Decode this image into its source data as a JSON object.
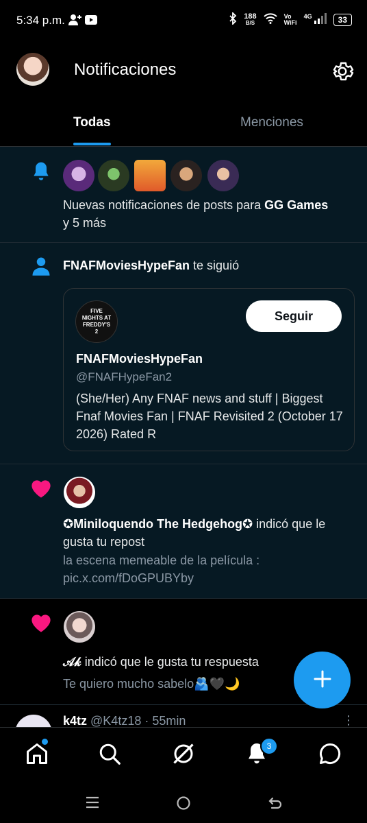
{
  "status_bar": {
    "time": "5:34 p.m.",
    "speed_top": "188",
    "speed_unit": "B/S",
    "network": "4G",
    "battery": "33"
  },
  "header": {
    "title": "Notificaciones"
  },
  "tabs": [
    {
      "label": "Todas",
      "active": true
    },
    {
      "label": "Menciones",
      "active": false
    }
  ],
  "notifications": {
    "n1": {
      "icon": "bell-icon",
      "text_a": "Nuevas notificaciones de posts para ",
      "text_bold": "GG Games",
      "text_b": " y 5 más"
    },
    "n2": {
      "icon": "person-icon",
      "user": "FNAFMoviesHypeFan",
      "action": " te siguió",
      "card": {
        "avatar_text": "FIVE NIGHTS AT FREDDY'S 2",
        "name": "FNAFMoviesHypeFan",
        "handle": "@FNAFHypeFan2",
        "bio": "(She/Her) Any FNAF news and stuff | Biggest Fnaf Movies Fan | FNAF Revisited 2 (October 17 2026) Rated R",
        "follow_label": "Seguir"
      }
    },
    "n3": {
      "icon": "heart-icon",
      "user": "✪Miniloquendo The Hedgehog✪",
      "action": " indicó que le gusta tu repost",
      "preview": "la escena memeable de la película : pic.x.com/fDoGPUBYby"
    },
    "n4": {
      "icon": "heart-icon",
      "user": "𝒜𝓀",
      "action": " indicó que le gusta tu respuesta",
      "preview": "Te quiero mucho sabelo🫂🖤🌙"
    },
    "n5": {
      "user": "k4tz",
      "handle": "@K4tz18",
      "time": "· 55min"
    }
  },
  "bottom_nav": {
    "notif_badge": "3"
  },
  "colors": {
    "accent": "#1d9bf0",
    "like": "#f91880",
    "unread_bg": "#061923"
  }
}
